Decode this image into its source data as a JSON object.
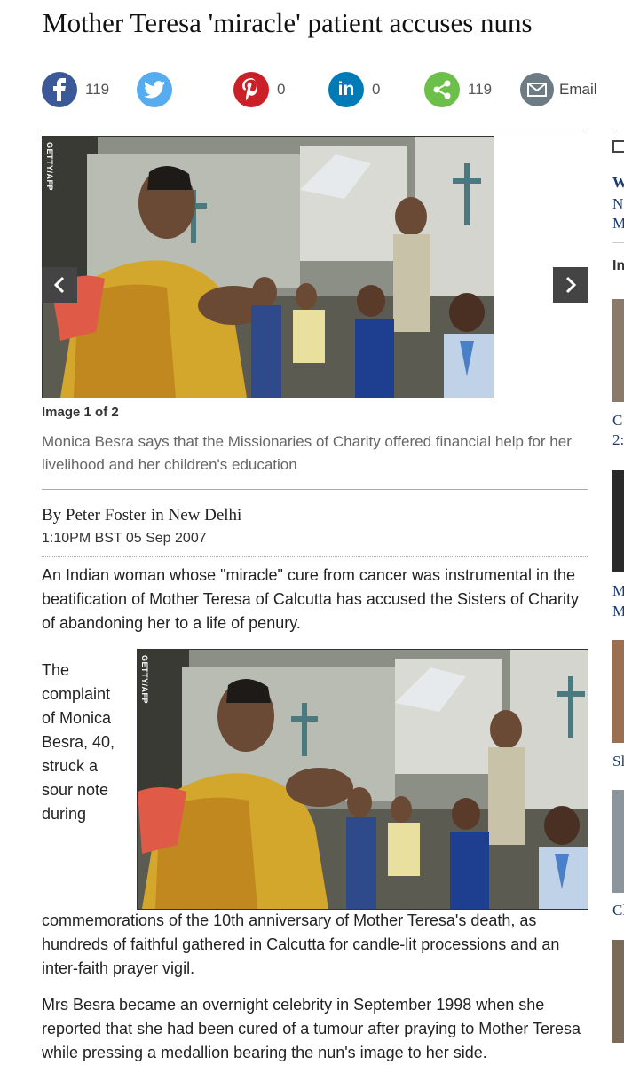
{
  "article": {
    "headline": "Mother Teresa 'miracle' patient accuses nuns",
    "byline": "By Peter Foster in New Delhi",
    "date": "1:10PM BST 05 Sep 2007",
    "para1": "An Indian woman whose \"miracle\" cure from cancer was instrumental in the beatification of Mother Teresa of Calcutta has accused the Sisters of Charity of abandoning her to a life of penury.",
    "para2_wrap": [
      "The",
      "complaint",
      "of Monica",
      "Besra, 40,",
      "struck a",
      "sour note",
      "during"
    ],
    "para2_rest": "commemorations of the 10th anniversary of Mother Teresa's death, as hundreds of faithful gathered in Calcutta for candle-lit processions and an inter-faith prayer vigil.",
    "para3": "Mrs Besra became an overnight celebrity in September 1998 when she reported that she had been cured of a tumour after praying to Mother Teresa while pressing a medallion bearing the nun's image to her side."
  },
  "share": {
    "facebook_count": "119",
    "pinterest_count": "0",
    "linkedin_count": "0",
    "share_count": "119",
    "email_label": "Email",
    "colors": {
      "facebook": "#3b5998",
      "twitter": "#55acee",
      "pinterest": "#cb2027",
      "linkedin": "#007bb6",
      "share": "#6cc04a",
      "email": "#6d7b85"
    }
  },
  "gallery": {
    "counter": "Image 1 of 2",
    "caption": "Monica Besra says that the Missionaries of Charity offered financial help for her livelihood and her children's education",
    "credit": "GETTY/AFP"
  },
  "inline_image": {
    "credit": "GETTY/AFP"
  },
  "sidebar": {
    "heading1": "W",
    "line1": "N",
    "line2": "M",
    "heading2": "In",
    "t1": "C",
    "t1b": "2:",
    "t2": "M",
    "t2b": "M",
    "t3": "Sl",
    "t4": "Cl"
  }
}
